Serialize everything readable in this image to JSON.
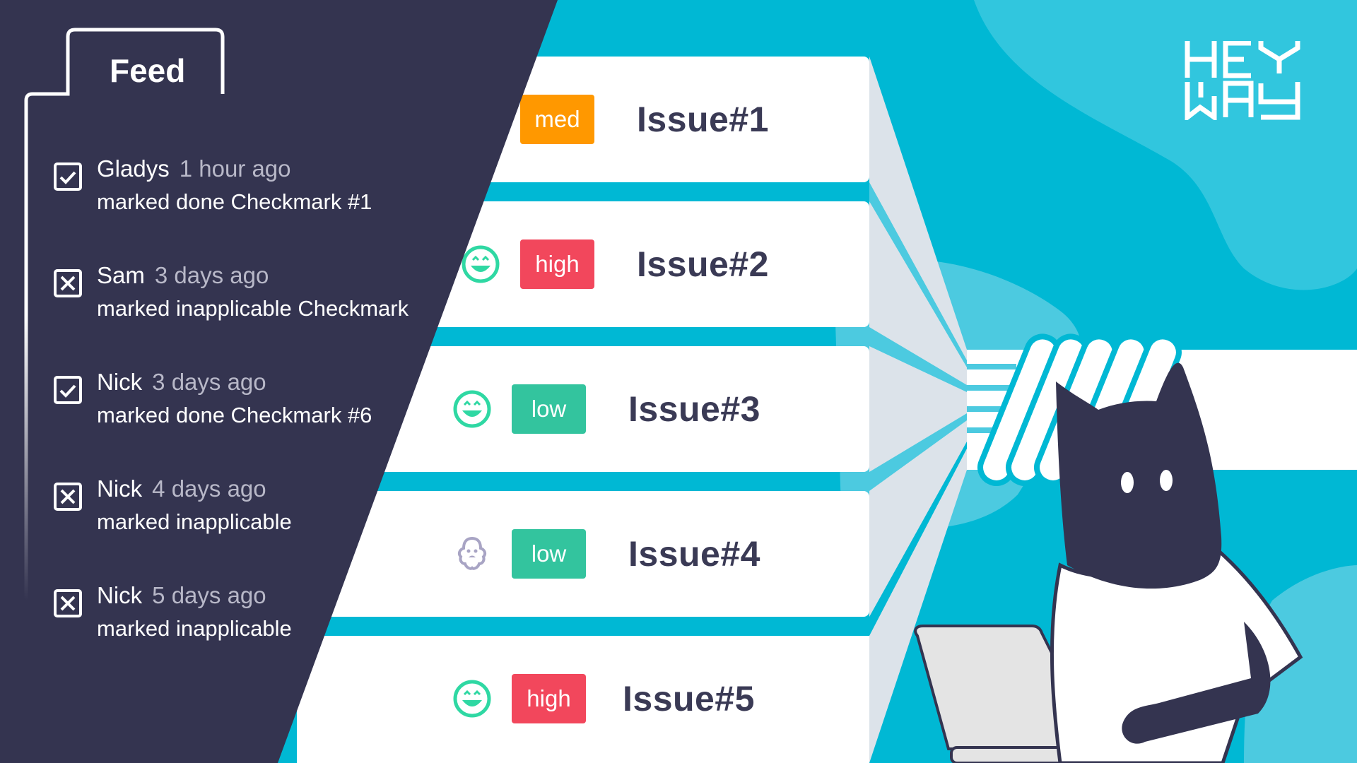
{
  "brand": {
    "name": "HEY WAY",
    "color_dark": "#343450",
    "color_cyan": "#00b8d4",
    "color_cyan_light": "#4ccae0"
  },
  "feed": {
    "title": "Feed",
    "items": [
      {
        "icon": "checkbox-checked-icon",
        "user": "Gladys",
        "time": "1 hour ago",
        "action": "marked done Checkmark #1"
      },
      {
        "icon": "checkbox-x-icon",
        "user": "Sam",
        "time": "3 days ago",
        "action": "marked inapplicable Checkmark"
      },
      {
        "icon": "checkbox-checked-icon",
        "user": "Nick",
        "time": "3 days ago",
        "action": "marked done Checkmark #6"
      },
      {
        "icon": "checkbox-x-icon",
        "user": "Nick",
        "time": "4 days ago",
        "action": "marked inapplicable"
      },
      {
        "icon": "checkbox-x-icon",
        "user": "Nick",
        "time": "5 days ago",
        "action": "marked inapplicable"
      }
    ]
  },
  "issues": [
    {
      "title": "Issue#1",
      "priority": "med",
      "priority_color": "#ff9800",
      "mood": "smiley-icon"
    },
    {
      "title": "Issue#2",
      "priority": "high",
      "priority_color": "#f2475c",
      "mood": "smiley-icon"
    },
    {
      "title": "Issue#3",
      "priority": "low",
      "priority_color": "#33c49e",
      "mood": "smiley-icon"
    },
    {
      "title": "Issue#4",
      "priority": "low",
      "priority_color": "#33c49e",
      "mood": "ghost-icon"
    },
    {
      "title": "Issue#5",
      "priority": "high",
      "priority_color": "#f2475c",
      "mood": "smiley-icon"
    }
  ]
}
